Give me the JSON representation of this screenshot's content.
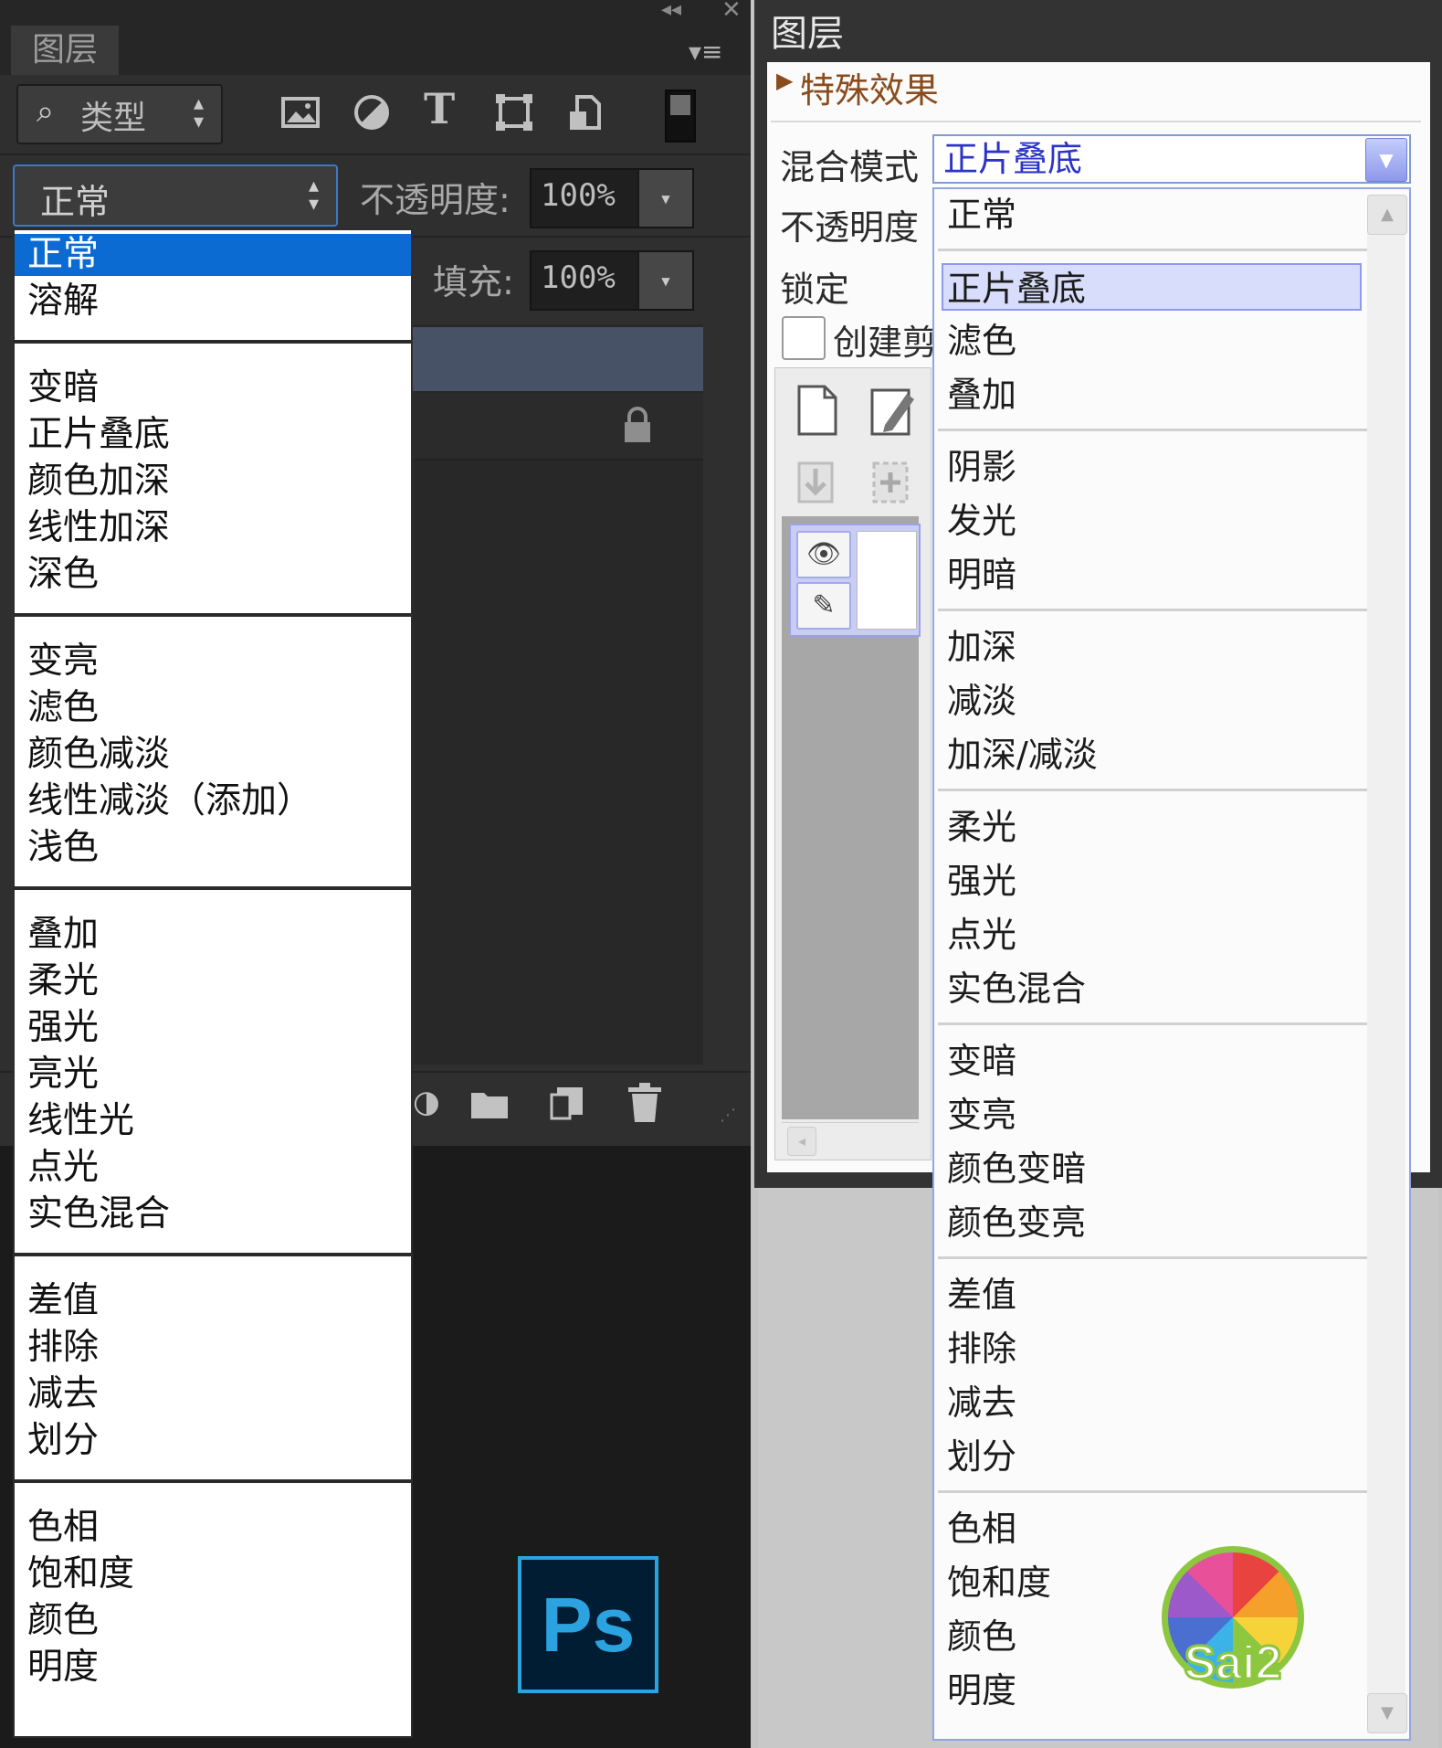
{
  "ps": {
    "panel_tab": "图层",
    "filter_label": "类型",
    "blend_mode_value": "正常",
    "opacity_label": "不透明度:",
    "opacity_value": "100%",
    "fill_label": "填充:",
    "fill_value": "100%",
    "badge": "Ps",
    "icons": [
      "image-filter-icon",
      "adjustment-filter-icon",
      "type-filter-icon",
      "shape-filter-icon",
      "smart-object-filter-icon",
      "filter-toggle-icon",
      "lock-icon",
      "folder-icon",
      "new-layer-icon",
      "trash-icon"
    ],
    "blend_menu_groups": [
      [
        "正常",
        "溶解"
      ],
      [
        "变暗",
        "正片叠底",
        "颜色加深",
        "线性加深",
        "深色"
      ],
      [
        "变亮",
        "滤色",
        "颜色减淡",
        "线性减淡（添加）",
        "浅色"
      ],
      [
        "叠加",
        "柔光",
        "强光",
        "亮光",
        "线性光",
        "点光",
        "实色混合"
      ],
      [
        "差值",
        "排除",
        "减去",
        "划分"
      ],
      [
        "色相",
        "饱和度",
        "颜色",
        "明度"
      ]
    ],
    "selected_item": "正常"
  },
  "sai": {
    "title": "图层",
    "effects_label": "特殊效果",
    "blend_label": "混合模式",
    "blend_value": "正片叠底",
    "opacity_label": "不透明度",
    "lock_label": "锁定",
    "clip_label": "创建剪",
    "logo_text": "Sai2",
    "blend_menu_groups": [
      [
        "正常"
      ],
      [
        "正片叠底",
        "滤色",
        "叠加"
      ],
      [
        "阴影",
        "发光",
        "明暗"
      ],
      [
        "加深",
        "减淡",
        "加深/减淡"
      ],
      [
        "柔光",
        "强光",
        "点光",
        "实色混合"
      ],
      [
        "变暗",
        "变亮",
        "颜色变暗",
        "颜色变亮"
      ],
      [
        "差值",
        "排除",
        "减去",
        "划分"
      ],
      [
        "色相",
        "饱和度",
        "颜色",
        "明度"
      ]
    ],
    "selected_item": "正片叠底"
  },
  "colors": {
    "ps_selection": "#0b6bd3",
    "ps_badge": "#2aa3e0",
    "sai_selection": "#d8ddfb",
    "sai_blend_text": "#2b34c7",
    "sai_effects_text": "#8a4c1d"
  }
}
